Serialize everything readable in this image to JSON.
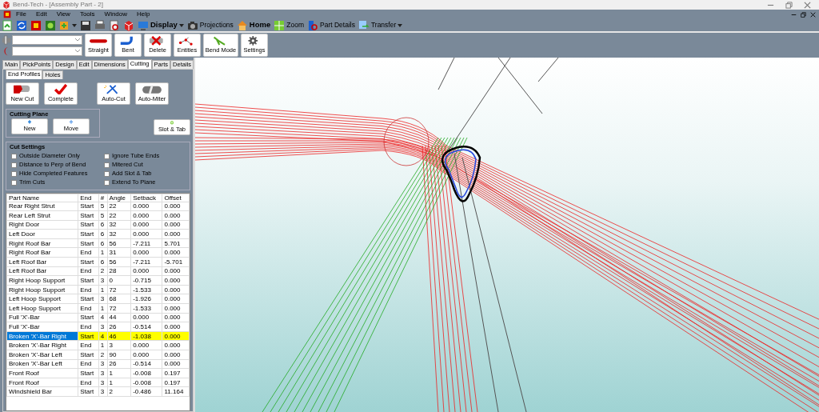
{
  "window": {
    "title": "Bend-Tech - [Assembly Part - 2]"
  },
  "menu": [
    "File",
    "Edit",
    "View",
    "Tools",
    "Window",
    "Help"
  ],
  "toolbar": [
    {
      "kind": "icon"
    },
    {
      "kind": "icon"
    },
    {
      "kind": "icon"
    },
    {
      "kind": "icon"
    },
    {
      "kind": "icon",
      "dropdown": true
    },
    {
      "kind": "icon"
    },
    {
      "kind": "icon"
    },
    {
      "kind": "icon"
    },
    {
      "kind": "icon"
    },
    {
      "kind": "labeled",
      "label": "Display",
      "bold": true,
      "dropdown": true
    },
    {
      "kind": "labeled",
      "label": "Projections",
      "bold": false,
      "dropdown": false
    },
    {
      "kind": "labeled",
      "label": "Home",
      "bold": true,
      "dropdown": false
    },
    {
      "kind": "labeled",
      "label": "Zoom",
      "bold": false,
      "dropdown": false
    },
    {
      "kind": "labeled",
      "label": "Part Details",
      "bold": false,
      "dropdown": false
    },
    {
      "kind": "labeled",
      "label": "Transfer",
      "bold": false,
      "dropdown": true
    }
  ],
  "big_buttons": [
    "Straight",
    "Bent",
    "Delete",
    "Entities",
    "Bend Mode",
    "Settings"
  ],
  "tabs": [
    {
      "label": "Main",
      "selected": false
    },
    {
      "label": "PickPoints",
      "selected": false
    },
    {
      "label": "Design",
      "selected": false
    },
    {
      "label": "Edit",
      "selected": false
    },
    {
      "label": "Dimensions",
      "selected": false
    },
    {
      "label": "Cutting",
      "selected": true
    },
    {
      "label": "Parts",
      "selected": false
    },
    {
      "label": "Details",
      "selected": false
    }
  ],
  "subtabs": [
    {
      "label": "End Profiles",
      "selected": true
    },
    {
      "label": "Holes",
      "selected": false
    }
  ],
  "cut_buttons": [
    "New Cut",
    "Complete",
    "Auto-Cut",
    "Auto-Miter"
  ],
  "cutting_plane": {
    "title": "Cutting Plane",
    "buttons": [
      "New",
      "Move"
    ]
  },
  "slot_tab": {
    "label": "Slot & Tab"
  },
  "cut_settings": {
    "title": "Cut Settings",
    "options": [
      {
        "label": "Outside Diameter Only",
        "checked": false
      },
      {
        "label": "Ignore Tube Ends",
        "checked": false
      },
      {
        "label": "Distance to Perp of Bend",
        "checked": false
      },
      {
        "label": "Mitered Cut",
        "checked": false
      },
      {
        "label": "Hide Completed Features",
        "checked": false
      },
      {
        "label": "Add Slot & Tab",
        "checked": false
      },
      {
        "label": "Trim Cuts",
        "checked": false
      },
      {
        "label": "Extend To Plane",
        "checked": false
      }
    ]
  },
  "table": {
    "columns": [
      "Part Name",
      "End",
      "#",
      "Angle",
      "Setback",
      "Offset"
    ],
    "rows": [
      {
        "cells": [
          "Rear Right Strut",
          "Start",
          "5",
          "22",
          "0.000",
          "0.000"
        ],
        "selected": false
      },
      {
        "cells": [
          "Rear Left Strut",
          "Start",
          "5",
          "22",
          "0.000",
          "0.000"
        ],
        "selected": false
      },
      {
        "cells": [
          "Right Door",
          "Start",
          "6",
          "32",
          "0.000",
          "0.000"
        ],
        "selected": false
      },
      {
        "cells": [
          "Left Door",
          "Start",
          "6",
          "32",
          "0.000",
          "0.000"
        ],
        "selected": false
      },
      {
        "cells": [
          "Right Roof Bar",
          "Start",
          "6",
          "56",
          "-7.211",
          "5.701"
        ],
        "selected": false
      },
      {
        "cells": [
          "Right Roof Bar",
          "End",
          "1",
          "31",
          "0.000",
          "0.000"
        ],
        "selected": false
      },
      {
        "cells": [
          "Left Roof Bar",
          "Start",
          "6",
          "56",
          "-7.211",
          "-5.701"
        ],
        "selected": false
      },
      {
        "cells": [
          "Left Roof Bar",
          "End",
          "2",
          "28",
          "0.000",
          "0.000"
        ],
        "selected": false
      },
      {
        "cells": [
          "Right Hoop Support",
          "Start",
          "3",
          "0",
          "-0.715",
          "0.000"
        ],
        "selected": false
      },
      {
        "cells": [
          "Right Hoop Support",
          "End",
          "1",
          "72",
          "-1.533",
          "0.000"
        ],
        "selected": false
      },
      {
        "cells": [
          "Left Hoop Support",
          "Start",
          "3",
          "68",
          "-1.926",
          "0.000"
        ],
        "selected": false
      },
      {
        "cells": [
          "Left Hoop Support",
          "End",
          "1",
          "72",
          "-1.533",
          "0.000"
        ],
        "selected": false
      },
      {
        "cells": [
          "Full 'X'-Bar",
          "Start",
          "4",
          "44",
          "0.000",
          "0.000"
        ],
        "selected": false
      },
      {
        "cells": [
          "Full 'X'-Bar",
          "End",
          "3",
          "26",
          "-0.514",
          "0.000"
        ],
        "selected": false
      },
      {
        "cells": [
          "Broken 'X'-Bar Right",
          "Start",
          "4",
          "46",
          "-1.038",
          "0.000"
        ],
        "selected": true
      },
      {
        "cells": [
          "Broken 'X'-Bar Right",
          "End",
          "1",
          "3",
          "0.000",
          "0.000"
        ],
        "selected": false
      },
      {
        "cells": [
          "Broken 'X'-Bar Left",
          "Start",
          "2",
          "90",
          "0.000",
          "0.000"
        ],
        "selected": false
      },
      {
        "cells": [
          "Broken 'X'-Bar Left",
          "End",
          "3",
          "26",
          "-0.514",
          "0.000"
        ],
        "selected": false
      },
      {
        "cells": [
          "Front Roof",
          "Start",
          "3",
          "1",
          "-0.008",
          "0.197"
        ],
        "selected": false
      },
      {
        "cells": [
          "Front Roof",
          "End",
          "3",
          "1",
          "-0.008",
          "0.197"
        ],
        "selected": false
      },
      {
        "cells": [
          "Windshield Bar",
          "Start",
          "3",
          "2",
          "-0.486",
          "11.164"
        ],
        "selected": false
      }
    ]
  }
}
